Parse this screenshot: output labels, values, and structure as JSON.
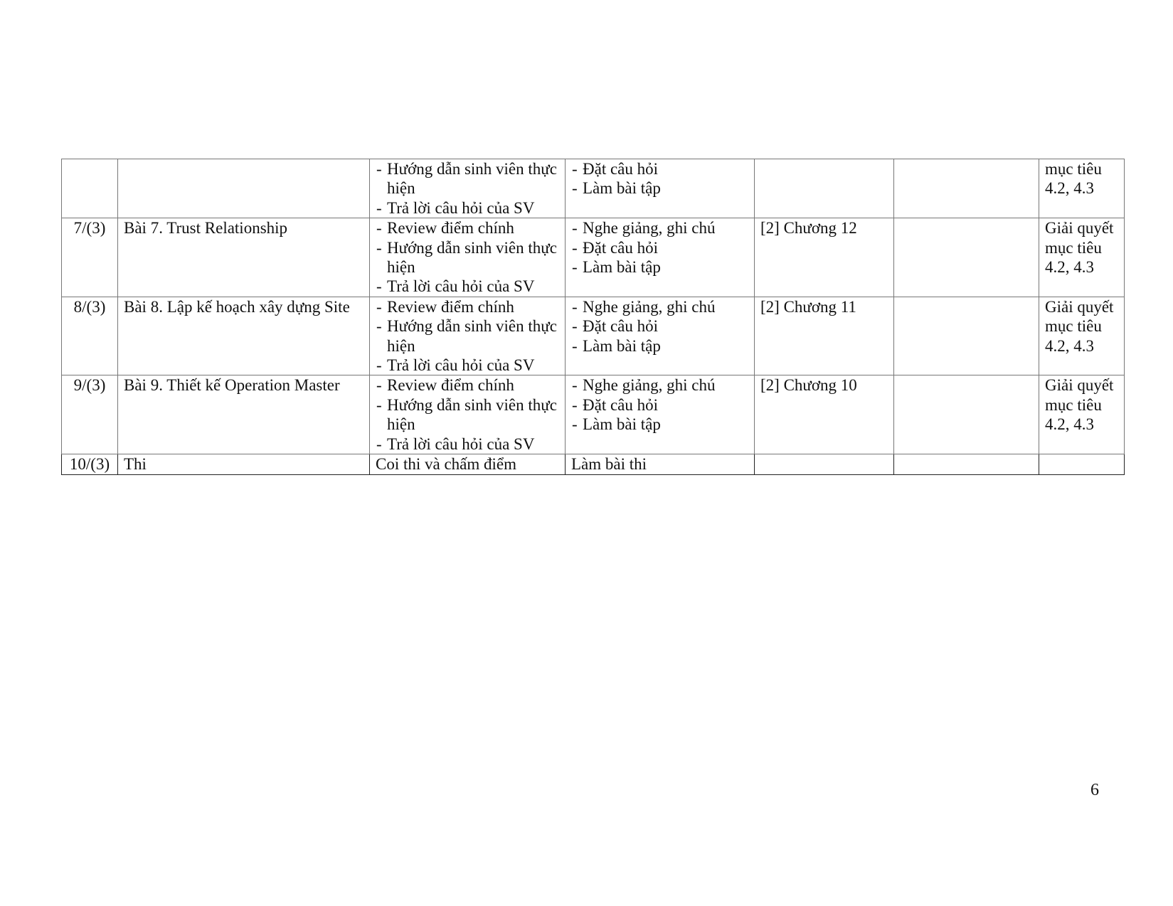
{
  "rows": [
    {
      "week": "",
      "lesson": "",
      "teacher": [
        "Hướng dẫn sinh viên thực hiện",
        "Trả lời câu hỏi của SV"
      ],
      "student": [
        "Đặt câu hỏi",
        "Làm bài tập"
      ],
      "ref": "",
      "extra": "",
      "goal": "mục tiêu 4.2, 4.3"
    },
    {
      "week": "7/(3)",
      "lesson": "Bài 7. Trust Relationship",
      "teacher": [
        "Review điểm chính",
        "Hướng dẫn sinh viên thực hiện",
        "Trả lời câu hỏi của SV"
      ],
      "student": [
        "Nghe giảng, ghi chú",
        "Đặt câu hỏi",
        "Làm bài tập"
      ],
      "ref": "[2] Chương 12",
      "extra": "",
      "goal": "Giải quyết mục tiêu 4.2, 4.3"
    },
    {
      "week": "8/(3)",
      "lesson": "Bài 8. Lập kế hoạch xây dựng Site",
      "teacher": [
        "Review điểm chính",
        "Hướng dẫn sinh viên thực hiện",
        "Trả lời câu hỏi của SV"
      ],
      "student": [
        "Nghe giảng, ghi chú",
        "Đặt câu hỏi",
        "Làm bài tập"
      ],
      "ref": "[2] Chương 11",
      "extra": "",
      "goal": "Giải quyết mục tiêu 4.2, 4.3"
    },
    {
      "week": "9/(3)",
      "lesson": "Bài 9. Thiết kế Operation Master",
      "teacher": [
        "Review điểm chính",
        "Hướng dẫn sinh viên thực hiện",
        "Trả lời câu hỏi của SV"
      ],
      "student": [
        "Nghe giảng, ghi chú",
        "Đặt câu hỏi",
        "Làm bài tập"
      ],
      "ref": "[2] Chương 10",
      "extra": "",
      "goal": "Giải quyết mục tiêu 4.2, 4.3"
    }
  ],
  "final_row": {
    "week": "10/(3)",
    "lesson": "Thi",
    "teacher": "Coi thi và chấm điểm",
    "student": "Làm bài thi",
    "ref": "",
    "extra": "",
    "goal": ""
  },
  "page_number": "6"
}
